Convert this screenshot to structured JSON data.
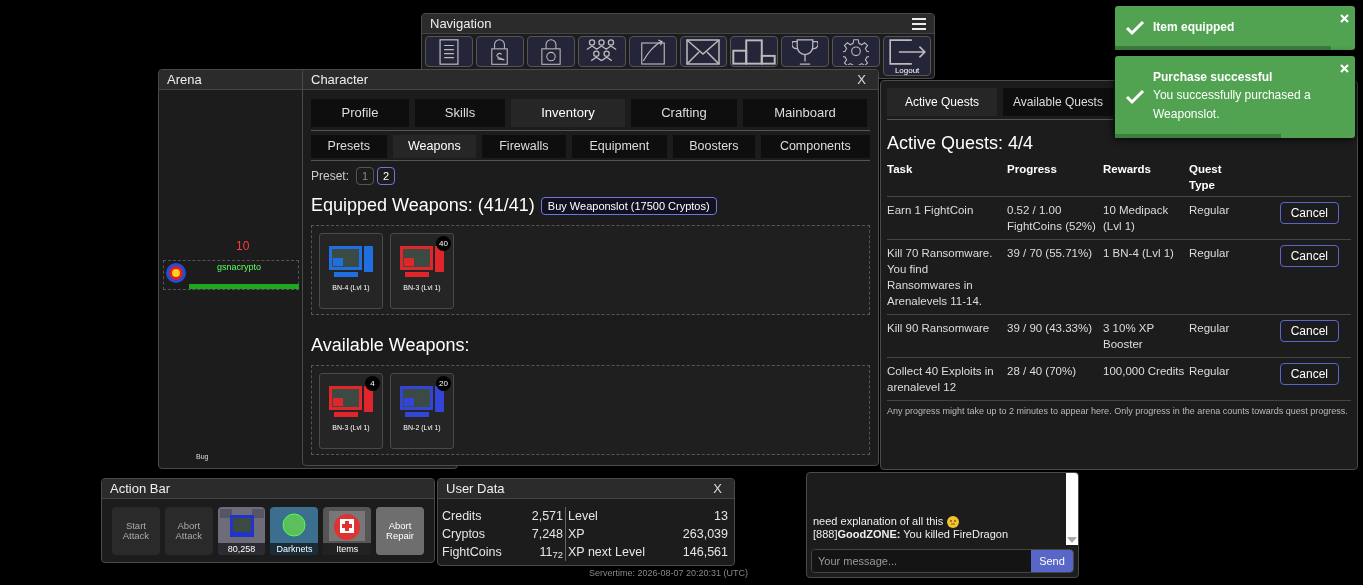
{
  "navigation": {
    "title": "Navigation",
    "buttons": [
      {
        "kind": "clipboard"
      },
      {
        "kind": "bag"
      },
      {
        "kind": "coinbag"
      },
      {
        "kind": "people"
      },
      {
        "kind": "chart"
      },
      {
        "kind": "mail"
      },
      {
        "kind": "podium"
      },
      {
        "kind": "trophy"
      },
      {
        "kind": "gear"
      },
      {
        "kind": "logout",
        "label": "Logout"
      }
    ]
  },
  "arena": {
    "title": "Arena",
    "enemy_level": "10",
    "player_name": "gsnacrypto",
    "health": {
      "level": 1
    },
    "tag": "Bug"
  },
  "character": {
    "title": "Character",
    "close": "X",
    "tabs": [
      {
        "label": "Profile",
        "selected": false
      },
      {
        "label": "Skills",
        "selected": false
      },
      {
        "label": "Inventory",
        "selected": true
      },
      {
        "label": "Crafting",
        "selected": false
      },
      {
        "label": "Mainboard",
        "selected": false
      }
    ],
    "subtabs": [
      {
        "label": "Presets",
        "selected": false
      },
      {
        "label": "Weapons",
        "selected": true
      },
      {
        "label": "Firewalls",
        "selected": false
      },
      {
        "label": "Equipment",
        "selected": false
      },
      {
        "label": "Boosters",
        "selected": false
      },
      {
        "label": "Components",
        "selected": false
      }
    ],
    "preset_label": "Preset:",
    "presets": [
      {
        "label": "1",
        "selected": false
      },
      {
        "label": "2",
        "selected": true
      }
    ],
    "equipped_title": "Equipped Weapons: (41/41)",
    "buy_button": "Buy Weaponslot (17500 Cryptos)",
    "equipped": [
      {
        "name": "BN-4 (Lvl 1)",
        "color": "#1f6fe0"
      },
      {
        "name": "BN-3 (Lvl 1)",
        "color": "#e0262b",
        "count": "40"
      }
    ],
    "available_title": "Available Weapons:",
    "available": [
      {
        "name": "BN-3 (Lvl 1)",
        "color": "#e0262b",
        "count": "4"
      },
      {
        "name": "BN-2 (Lvl 1)",
        "color": "#3345d6",
        "count": "20"
      }
    ]
  },
  "quests": {
    "tabs": [
      {
        "label": "Active Quests",
        "selected": true
      },
      {
        "label": "Available Quests",
        "selected": false
      }
    ],
    "heading": "Active Quests: 4/4",
    "columns": [
      "Task",
      "Progress",
      "Rewards",
      "Quest Type"
    ],
    "rows": [
      {
        "task": "Earn 1 FightCoin",
        "progress": "0.52 / 1.00 FightCoins (52%)",
        "rewards": "10 Medipack (Lvl 1)",
        "type": "Regular",
        "action": "Cancel"
      },
      {
        "task": "Kill 70 Ransomware. You find Ransomwares in Arenalevels 11-14.",
        "progress": "39 / 70 (55.71%)",
        "rewards": "1 BN-4 (Lvl 1)",
        "type": "Regular",
        "action": "Cancel"
      },
      {
        "task": "Kill 90 Ransomware",
        "progress": "39 / 90 (43.33%)",
        "rewards": "3 10% XP Booster",
        "type": "Regular",
        "action": "Cancel"
      },
      {
        "task": "Collect 40 Exploits in arenalevel 12",
        "progress": "28 / 40 (70%)",
        "rewards": "100,000 Credits",
        "type": "Regular",
        "action": "Cancel"
      }
    ],
    "note": "Any progress might take up to 2 minutes to appear here. Only progress in the arena counts towards quest progress."
  },
  "action_bar": {
    "title": "Action Bar",
    "buttons": [
      {
        "kind": "plain",
        "label": "Start Attack",
        "disabled": true
      },
      {
        "kind": "plain",
        "label": "Abort Attack",
        "disabled": true
      },
      {
        "kind": "computers",
        "label": "80,258"
      },
      {
        "kind": "darknets",
        "label": "Darknets"
      },
      {
        "kind": "items",
        "label": "Items"
      },
      {
        "kind": "plain",
        "label": "Abort Repair",
        "disabled": false
      }
    ]
  },
  "user_data": {
    "title": "User Data",
    "close": "X",
    "left": [
      {
        "label": "Credits",
        "value": "2,571"
      },
      {
        "label": "Cryptos",
        "value": "7,248"
      },
      {
        "label": "FightCoins",
        "value": "11$_{72}$"
      }
    ],
    "right": [
      {
        "label": "Level",
        "value": "13"
      },
      {
        "label": "XP",
        "value": "263,039"
      },
      {
        "label": "XP next Level",
        "value": "146,561"
      }
    ]
  },
  "servertime": "Servertime: 2026-08-07 20:20:31 (UTC)",
  "chat": {
    "messages": [
      {
        "text": "need explanation of all this",
        "emoji": true
      },
      {
        "text": "[888]**GoodZONE:** You killed FireDragon",
        "emoji": false
      }
    ],
    "placeholder": "Your message...",
    "send": "Send"
  },
  "notifications": [
    {
      "title": "Item equipped",
      "level": 0.9
    },
    {
      "title": "Purchase successful",
      "message": "You successfully purchased a Weaponslot.",
      "level": 0.69
    }
  ]
}
